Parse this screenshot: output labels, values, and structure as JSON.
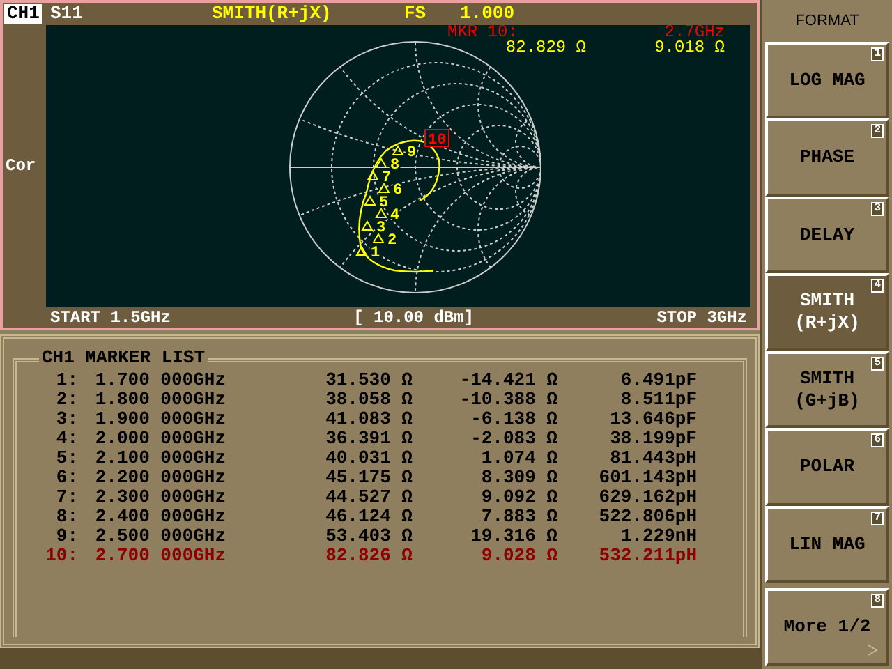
{
  "header": {
    "channel": "CH1",
    "parameter": "S11",
    "format": "SMITH(R+jX)",
    "scale_label": "FS",
    "scale_value": "1.000"
  },
  "marker_readout": {
    "label": "MKR 10:",
    "frequency": "2.7GHz",
    "resistance": "82.829 Ω",
    "reactance": "9.018 Ω"
  },
  "side_label": "Cor",
  "smith_markers": [
    {
      "label": "10",
      "active": true
    },
    {
      "label": "9",
      "active": false
    },
    {
      "label": "8",
      "active": false
    },
    {
      "label": "7",
      "active": false
    },
    {
      "label": "6",
      "active": false
    },
    {
      "label": "5",
      "active": false
    },
    {
      "label": "4",
      "active": false
    },
    {
      "label": "3",
      "active": false
    },
    {
      "label": "2",
      "active": false
    },
    {
      "label": "1",
      "active": false
    }
  ],
  "footer": {
    "start": "START 1.5GHz",
    "power": "[ 10.00 dBm]",
    "stop": "STOP 3GHz"
  },
  "marker_list": {
    "title": "CH1 MARKER LIST",
    "rows": [
      {
        "index": "1:",
        "frequency": "1.700 000GHz",
        "resistance": "31.530 Ω",
        "reactance": "-14.421 Ω",
        "component": "6.491pF",
        "active": false
      },
      {
        "index": "2:",
        "frequency": "1.800 000GHz",
        "resistance": "38.058 Ω",
        "reactance": "-10.388 Ω",
        "component": "8.511pF",
        "active": false
      },
      {
        "index": "3:",
        "frequency": "1.900 000GHz",
        "resistance": "41.083 Ω",
        "reactance": "-6.138 Ω",
        "component": "13.646pF",
        "active": false
      },
      {
        "index": "4:",
        "frequency": "2.000 000GHz",
        "resistance": "36.391 Ω",
        "reactance": "-2.083 Ω",
        "component": "38.199pF",
        "active": false
      },
      {
        "index": "5:",
        "frequency": "2.100 000GHz",
        "resistance": "40.031 Ω",
        "reactance": "1.074 Ω",
        "component": "81.443pH",
        "active": false
      },
      {
        "index": "6:",
        "frequency": "2.200 000GHz",
        "resistance": "45.175 Ω",
        "reactance": "8.309 Ω",
        "component": "601.143pH",
        "active": false
      },
      {
        "index": "7:",
        "frequency": "2.300 000GHz",
        "resistance": "44.527 Ω",
        "reactance": "9.092 Ω",
        "component": "629.162pH",
        "active": false
      },
      {
        "index": "8:",
        "frequency": "2.400 000GHz",
        "resistance": "46.124 Ω",
        "reactance": "7.883 Ω",
        "component": "522.806pH",
        "active": false
      },
      {
        "index": "9:",
        "frequency": "2.500 000GHz",
        "resistance": "53.403 Ω",
        "reactance": "19.316 Ω",
        "component": "1.229nH",
        "active": false
      },
      {
        "index": "10:",
        "frequency": "2.700 000GHz",
        "resistance": "82.826 Ω",
        "reactance": "9.028 Ω",
        "component": "532.211pH",
        "active": true
      }
    ]
  },
  "softkeys": {
    "title": "FORMAT",
    "keys": [
      {
        "lines": [
          "LOG MAG"
        ],
        "number": "1",
        "selected": false,
        "kind": "plain"
      },
      {
        "lines": [
          "PHASE"
        ],
        "number": "2",
        "selected": false,
        "kind": "plain"
      },
      {
        "lines": [
          "DELAY"
        ],
        "number": "3",
        "selected": false,
        "kind": "plain"
      },
      {
        "lines": [
          "SMITH",
          "(R+jX)"
        ],
        "number": "4",
        "selected": true,
        "kind": "plain"
      },
      {
        "lines": [
          "SMITH",
          "(G+jB)"
        ],
        "number": "5",
        "selected": false,
        "kind": "plain"
      },
      {
        "lines": [
          "POLAR"
        ],
        "number": "6",
        "selected": false,
        "kind": "plain"
      },
      {
        "lines": [
          "LIN MAG"
        ],
        "number": "7",
        "selected": false,
        "kind": "plain"
      },
      {
        "lines": [
          "More 1/2"
        ],
        "number": "8",
        "selected": false,
        "kind": "more"
      }
    ]
  }
}
